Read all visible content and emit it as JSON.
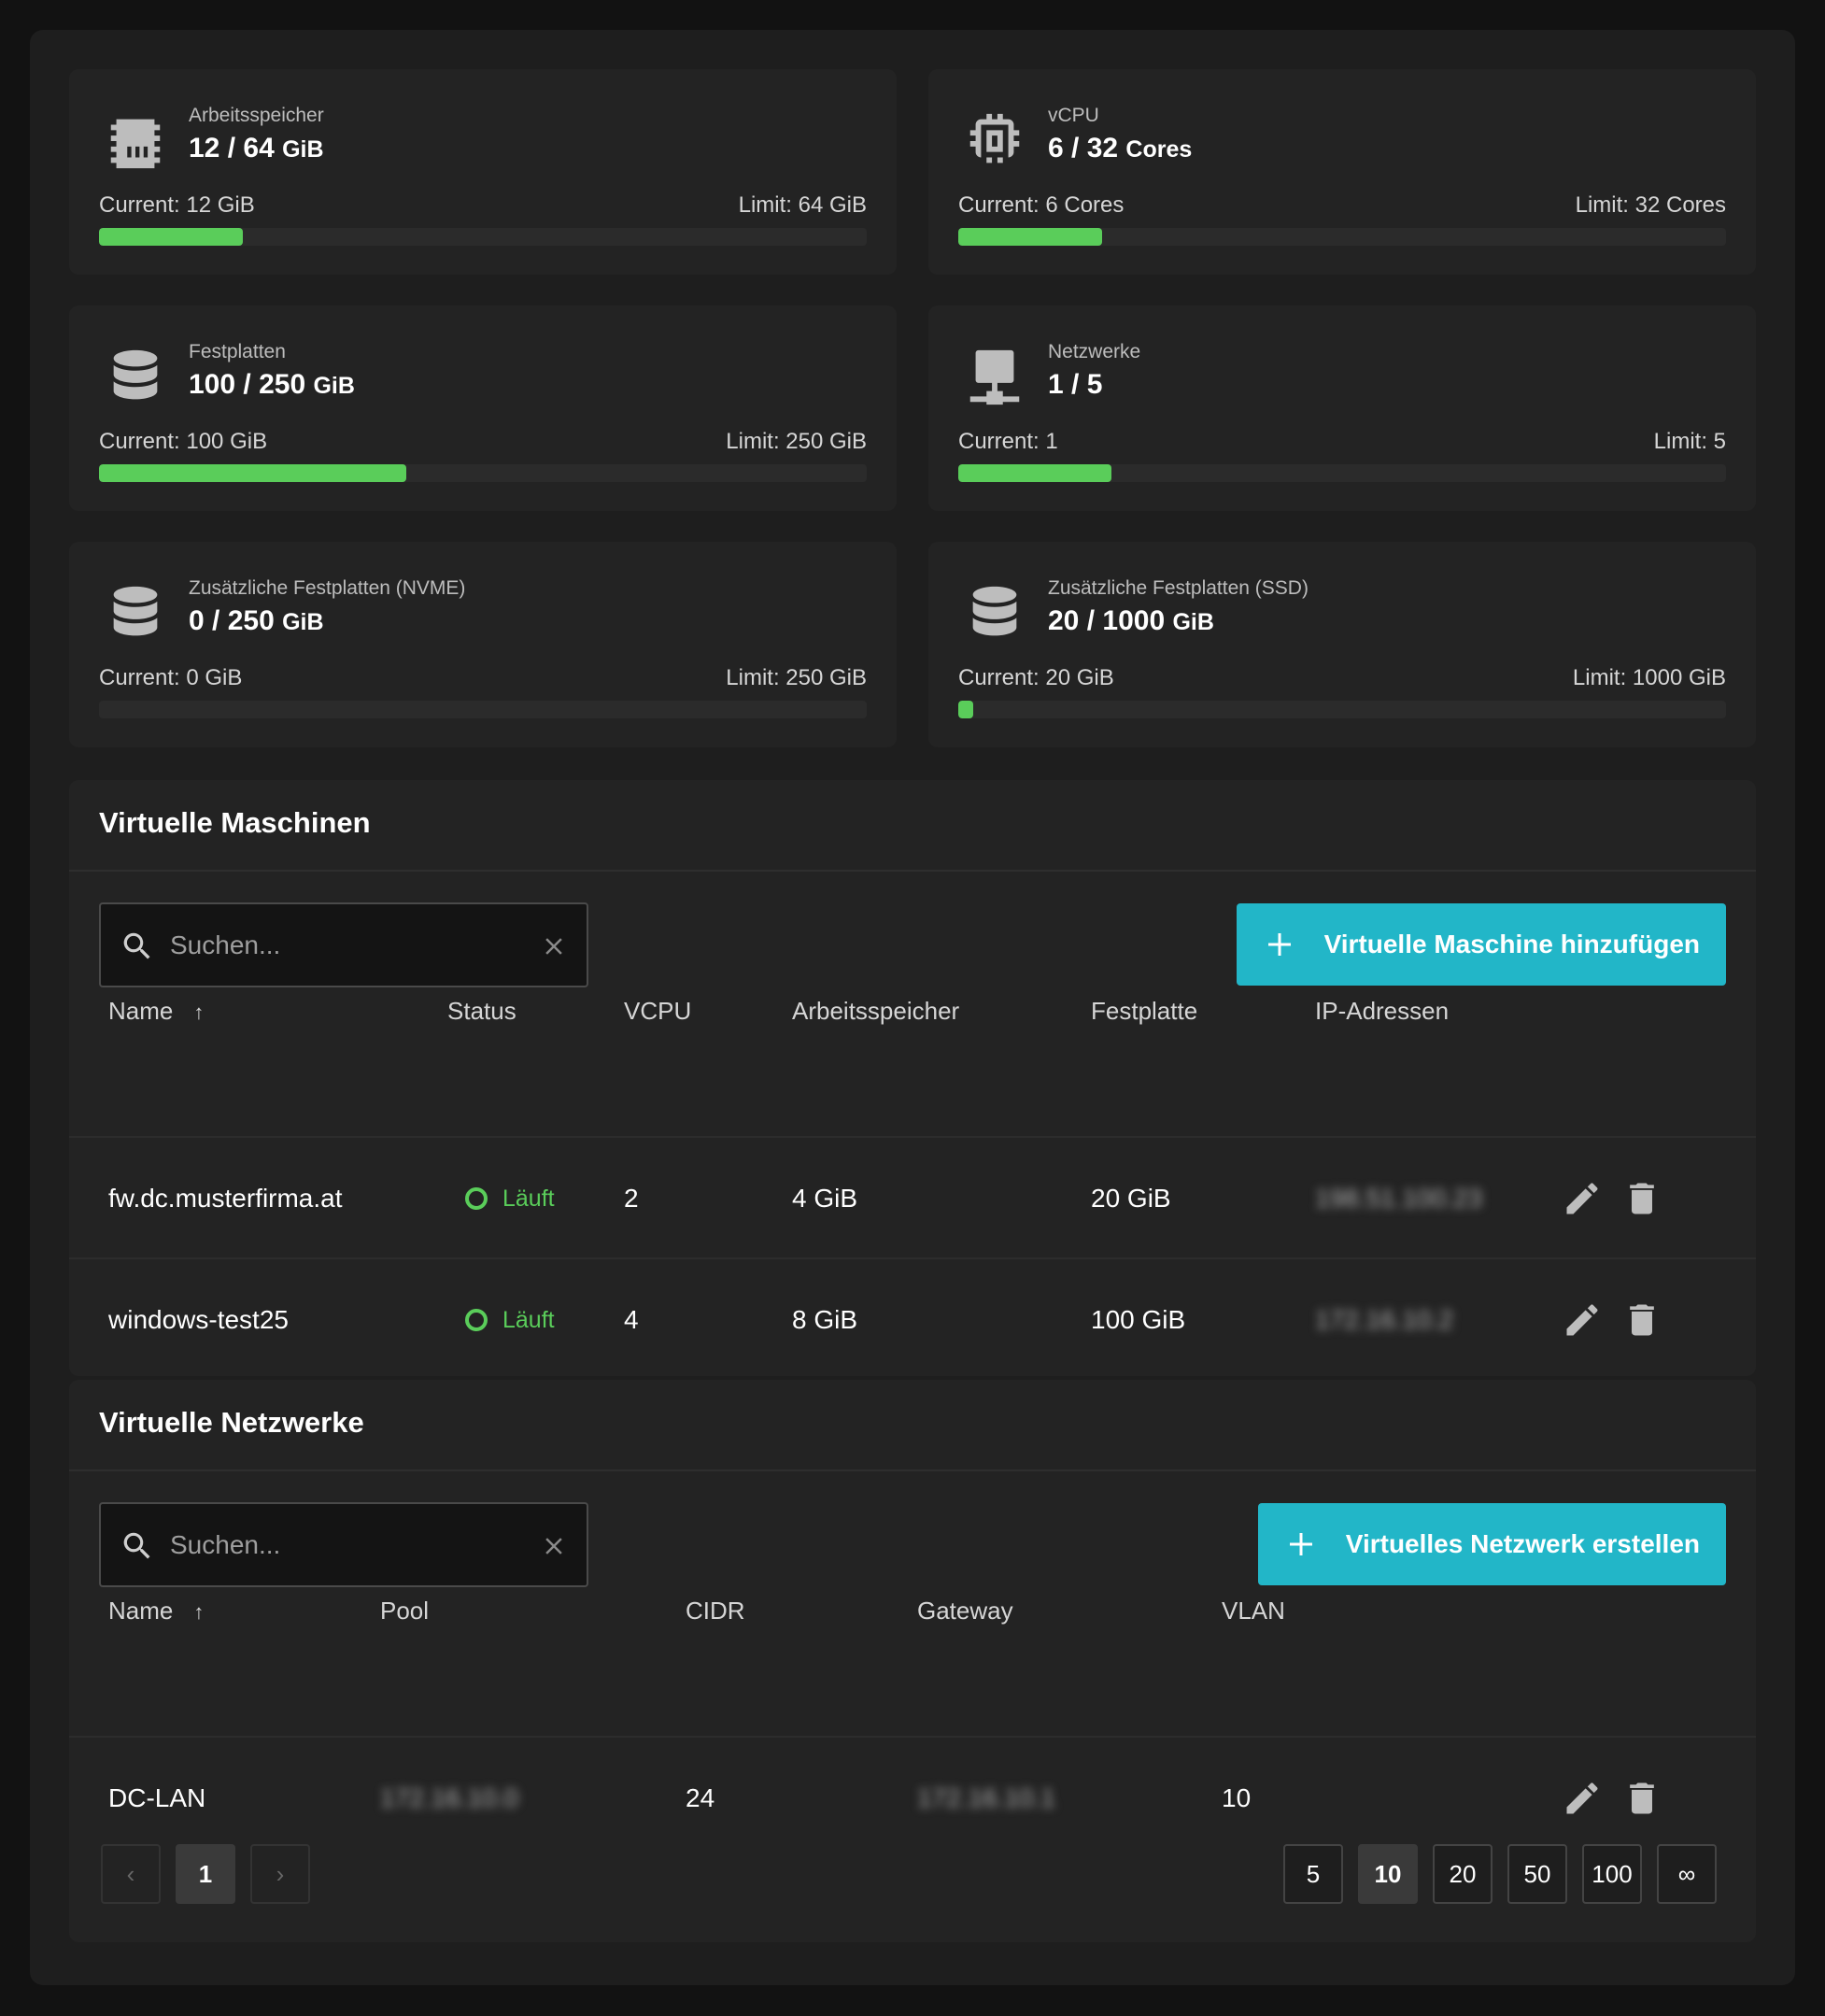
{
  "resources": [
    {
      "caption": "Arbeitsspeicher",
      "used": "12",
      "total": "64",
      "unit": "GiB",
      "current": "Current: 12 GiB",
      "limit": "Limit: 64 GiB",
      "fraction": 0.1875,
      "icon": "memory-icon"
    },
    {
      "caption": "vCPU",
      "used": "6",
      "total": "32",
      "unit": "Cores",
      "current": "Current: 6 Cores",
      "limit": "Limit: 32 Cores",
      "fraction": 0.1875,
      "icon": "cpu-icon"
    },
    {
      "caption": "Festplatten",
      "used": "100",
      "total": "250",
      "unit": "GiB",
      "current": "Current: 100 GiB",
      "limit": "Limit: 250 GiB",
      "fraction": 0.4,
      "icon": "database-icon"
    },
    {
      "caption": "Netzwerke",
      "used": "1",
      "total": "5",
      "unit": "",
      "current": "Current: 1",
      "limit": "Limit: 5",
      "fraction": 0.2,
      "icon": "network-icon"
    },
    {
      "caption": "Zusätzliche Festplatten (NVME)",
      "used": "0",
      "total": "250",
      "unit": "GiB",
      "current": "Current: 0 GiB",
      "limit": "Limit: 250 GiB",
      "fraction": 0,
      "icon": "database-icon"
    },
    {
      "caption": "Zusätzliche Festplatten (SSD)",
      "used": "20",
      "total": "1000",
      "unit": "GiB",
      "current": "Current: 20 GiB",
      "limit": "Limit: 1000 GiB",
      "fraction": 0.02,
      "icon": "database-icon"
    }
  ],
  "vm_panel": {
    "title": "Virtuelle Maschinen",
    "search_placeholder": "Suchen...",
    "add_label": "Virtuelle Maschine hinzufügen",
    "columns": {
      "name": "Name",
      "sort_arrow": "↑",
      "status": "Status",
      "vcpu": "VCPU",
      "memory": "Arbeitsspeicher",
      "disk": "Festplatte",
      "ip": "IP-Adressen"
    },
    "rows": [
      {
        "name": "fw.dc.musterfirma.at",
        "status": "Läuft",
        "vcpu": "2",
        "memory": "4 GiB",
        "disk": "20 GiB",
        "ip": "198.51.100.23"
      },
      {
        "name": "windows-test25",
        "status": "Läuft",
        "vcpu": "4",
        "memory": "8 GiB",
        "disk": "100 GiB",
        "ip": "172.16.10.2"
      }
    ]
  },
  "net_panel": {
    "title": "Virtuelle Netzwerke",
    "search_placeholder": "Suchen...",
    "add_label": "Virtuelles Netzwerk erstellen",
    "columns": {
      "name": "Name",
      "sort_arrow": "↑",
      "pool": "Pool",
      "cidr": "CIDR",
      "gateway": "Gateway",
      "vlan": "VLAN"
    },
    "rows": [
      {
        "name": "DC-LAN",
        "pool": "172.16.10.0",
        "cidr": "24",
        "gateway": "172.16.10.1",
        "vlan": "10"
      }
    ]
  },
  "pagination": {
    "prev": "‹",
    "current_page": "1",
    "next": "›",
    "page_sizes": [
      "5",
      "10",
      "20",
      "50",
      "100",
      "∞"
    ],
    "selected_size": "10"
  },
  "colors": {
    "accent": "#22b6c8",
    "progress": "#5acd5a",
    "status_running": "#5acd5a"
  }
}
